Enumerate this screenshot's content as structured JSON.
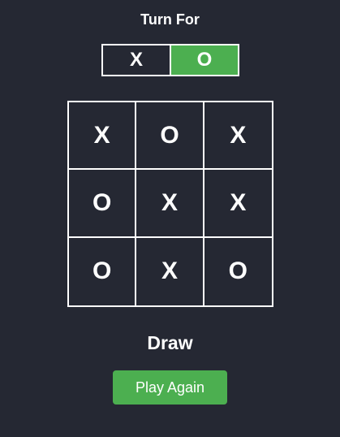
{
  "header": {
    "title": "Turn For"
  },
  "turn": {
    "x_label": "X",
    "o_label": "O",
    "active": "O",
    "active_color": "#4caf50"
  },
  "board": {
    "cells": [
      "X",
      "O",
      "X",
      "O",
      "X",
      "X",
      "O",
      "X",
      "O"
    ]
  },
  "status": {
    "result": "Draw"
  },
  "actions": {
    "play_again_label": "Play Again"
  },
  "colors": {
    "background": "#252833",
    "accent": "#4caf50",
    "foreground": "#ffffff"
  }
}
